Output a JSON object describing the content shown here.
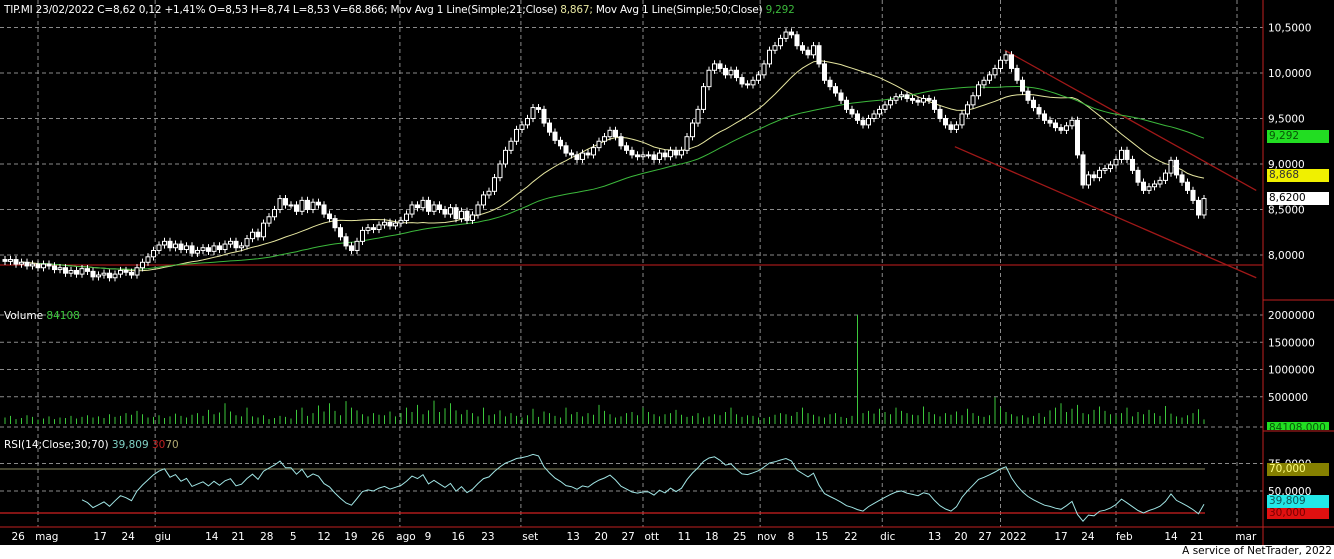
{
  "header": {
    "quote": "TIP.MI 23/02/2022 C=8,62 0,12 +1,41% O=8,53 H=8,74 L=8,53 V=68.866;",
    "ma21_label": "Mov Avg 1 Line(Simple;21;Close)",
    "ma21_value": "8,867;",
    "ma50_label": "Mov Avg 1 Line(Simple;50;Close)",
    "ma50_value": "9,292"
  },
  "volume_pane": {
    "label": "Volume",
    "value": "84108",
    "box": "84108,000"
  },
  "rsi_pane": {
    "label": "RSI(14;Close;30;70)",
    "value": "39,809",
    "low": "30",
    "high": "70",
    "box_high": "70,000",
    "box_value": "39,809",
    "box_low": "30,000"
  },
  "price_boxes": {
    "ma50": "9,292",
    "ma21": "8,868",
    "last": "8,6200"
  },
  "footer": "A service of NetTrader, 2022",
  "colors": {
    "ma21": "#e6e6a0",
    "ma50": "#3cb83c",
    "rsi": "#a0e4e4",
    "trend": "#a01818",
    "volume": "#3cc83c"
  },
  "chart_data": {
    "type": "candlestick",
    "symbol": "TIP.MI",
    "price_axis": {
      "ticks": [
        8.0,
        8.5,
        9.0,
        9.5,
        10.0,
        10.5
      ],
      "tick_labels": [
        "8,0000",
        "8,5000",
        "9,0000",
        "9,5000",
        "10,0000",
        "10,5000"
      ]
    },
    "volume_axis": {
      "ticks": [
        500000,
        1000000,
        1500000,
        2000000
      ],
      "tick_labels": [
        "500000",
        "1000000",
        "1500000",
        "2000000"
      ]
    },
    "rsi_axis": {
      "ticks": [
        50,
        75
      ],
      "tick_labels": [
        "50,0000",
        "75,0000"
      ],
      "levels": [
        30,
        70
      ]
    },
    "x_labels": [
      {
        "t": "26",
        "i": 2.4
      },
      {
        "t": "mag",
        "i": 7.6
      },
      {
        "t": "17",
        "i": 17.3
      },
      {
        "t": "24",
        "i": 22.4
      },
      {
        "t": "giu",
        "i": 28.7
      },
      {
        "t": "14",
        "i": 37.6
      },
      {
        "t": "21",
        "i": 42.4
      },
      {
        "t": "28",
        "i": 47.6
      },
      {
        "t": "5",
        "i": 52.4
      },
      {
        "t": "12",
        "i": 58
      },
      {
        "t": "19",
        "i": 62.9
      },
      {
        "t": "26",
        "i": 67.8
      },
      {
        "t": "ago",
        "i": 72.9
      },
      {
        "t": "9",
        "i": 76.9
      },
      {
        "t": "16",
        "i": 82.4
      },
      {
        "t": "23",
        "i": 87.8
      },
      {
        "t": "set",
        "i": 95.5
      },
      {
        "t": "13",
        "i": 103.3
      },
      {
        "t": "20",
        "i": 108.4
      },
      {
        "t": "27",
        "i": 113.3
      },
      {
        "t": "ott",
        "i": 117.6
      },
      {
        "t": "11",
        "i": 123.5
      },
      {
        "t": "18",
        "i": 128.5
      },
      {
        "t": "25",
        "i": 133.6
      },
      {
        "t": "nov",
        "i": 138.5
      },
      {
        "t": "8",
        "i": 142.9
      },
      {
        "t": "15",
        "i": 148.5
      },
      {
        "t": "22",
        "i": 153.8
      },
      {
        "t": "dic",
        "i": 160.5
      },
      {
        "t": "13",
        "i": 169
      },
      {
        "t": "20",
        "i": 173.8
      },
      {
        "t": "27",
        "i": 178.2
      },
      {
        "t": "2022",
        "i": 183.3
      },
      {
        "t": "17",
        "i": 192
      },
      {
        "t": "24",
        "i": 196.9
      },
      {
        "t": "feb",
        "i": 203.5
      },
      {
        "t": "14",
        "i": 212
      },
      {
        "t": "21",
        "i": 216.7
      },
      {
        "t": "mar",
        "i": 225.6
      }
    ],
    "month_gridlines": [
      6,
      27.3,
      71.8,
      93.8,
      116,
      137.3,
      159.5,
      181,
      202,
      224
    ],
    "support_level": 7.89,
    "trendlines": [
      {
        "from": [
          181.8,
          10.25
        ],
        "to": [
          227.5,
          8.71
        ]
      },
      {
        "from": [
          172.7,
          9.19
        ],
        "to": [
          227.5,
          7.75
        ]
      }
    ],
    "ma_periods": [
      21,
      50
    ],
    "rsi_period": 14,
    "close": [
      7.93,
      7.95,
      7.9,
      7.92,
      7.88,
      7.9,
      7.86,
      7.9,
      7.88,
      7.84,
      7.86,
      7.8,
      7.83,
      7.79,
      7.85,
      7.82,
      7.76,
      7.78,
      7.8,
      7.75,
      7.79,
      7.83,
      7.81,
      7.78,
      7.86,
      7.92,
      7.98,
      8.05,
      8.11,
      8.15,
      8.08,
      8.12,
      8.06,
      8.1,
      8.02,
      8.05,
      8.08,
      8.04,
      8.1,
      8.06,
      8.12,
      8.15,
      8.08,
      8.1,
      8.18,
      8.25,
      8.2,
      8.35,
      8.42,
      8.5,
      8.62,
      8.55,
      8.55,
      8.48,
      8.6,
      8.5,
      8.58,
      8.55,
      8.45,
      8.4,
      8.3,
      8.2,
      8.1,
      8.05,
      8.15,
      8.27,
      8.3,
      8.28,
      8.33,
      8.36,
      8.32,
      8.35,
      8.38,
      8.45,
      8.55,
      8.52,
      8.6,
      8.48,
      8.55,
      8.5,
      8.45,
      8.52,
      8.4,
      8.48,
      8.38,
      8.44,
      8.55,
      8.66,
      8.7,
      8.85,
      9.0,
      9.15,
      9.25,
      9.38,
      9.43,
      9.5,
      9.62,
      9.6,
      9.45,
      9.35,
      9.26,
      9.2,
      9.12,
      9.1,
      9.05,
      9.12,
      9.1,
      9.18,
      9.25,
      9.3,
      9.37,
      9.3,
      9.2,
      9.15,
      9.1,
      9.08,
      9.1,
      9.1,
      9.05,
      9.12,
      9.08,
      9.15,
      9.1,
      9.15,
      9.3,
      9.45,
      9.6,
      9.85,
      10.03,
      10.1,
      10.05,
      9.98,
      10.03,
      9.95,
      9.88,
      9.87,
      9.92,
      9.98,
      10.1,
      10.25,
      10.3,
      10.38,
      10.45,
      10.42,
      10.3,
      10.25,
      10.2,
      10.3,
      10.1,
      9.92,
      9.85,
      9.78,
      9.7,
      9.6,
      9.55,
      9.48,
      9.43,
      9.5,
      9.55,
      9.6,
      9.65,
      9.7,
      9.74,
      9.76,
      9.72,
      9.7,
      9.68,
      9.72,
      9.7,
      9.6,
      9.5,
      9.43,
      9.38,
      9.43,
      9.55,
      9.65,
      9.75,
      9.87,
      9.92,
      9.98,
      10.05,
      10.14,
      10.2,
      10.05,
      9.92,
      9.8,
      9.7,
      9.62,
      9.55,
      9.48,
      9.45,
      9.4,
      9.37,
      9.42,
      9.48,
      9.1,
      8.77,
      8.88,
      8.85,
      8.93,
      8.95,
      8.99,
      9.05,
      9.15,
      9.05,
      8.93,
      8.8,
      8.71,
      8.75,
      8.78,
      8.82,
      8.9,
      9.04,
      8.88,
      8.8,
      8.71,
      8.6,
      8.44,
      8.62
    ],
    "volume_k": [
      120,
      150,
      90,
      110,
      160,
      130,
      80,
      100,
      140,
      90,
      120,
      110,
      150,
      100,
      130,
      160,
      120,
      140,
      110,
      180,
      130,
      150,
      200,
      170,
      240,
      180,
      120,
      130,
      160,
      110,
      140,
      190,
      150,
      120,
      170,
      200,
      150,
      260,
      180,
      210,
      380,
      230,
      160,
      140,
      300,
      140,
      120,
      160,
      90,
      110,
      150,
      130,
      100,
      260,
      300,
      150,
      200,
      340,
      230,
      380,
      240,
      160,
      420,
      300,
      250,
      180,
      140,
      200,
      170,
      160,
      230,
      140,
      200,
      300,
      220,
      350,
      180,
      250,
      430,
      220,
      290,
      380,
      250,
      180,
      260,
      200,
      140,
      300,
      160,
      180,
      250,
      140,
      200,
      150,
      120,
      160,
      280,
      130,
      230,
      200,
      150,
      120,
      300,
      180,
      220,
      140,
      200,
      170,
      350,
      240,
      180,
      120,
      140,
      200,
      220,
      160,
      300,
      220,
      180,
      140,
      180,
      200,
      260,
      170,
      130,
      150,
      200,
      120,
      140,
      180,
      160,
      220,
      300,
      180,
      130,
      160,
      150,
      120,
      110,
      130,
      170,
      200,
      180,
      150,
      220,
      300,
      200,
      170,
      140,
      120,
      180,
      200,
      130,
      110,
      150,
      2000,
      200,
      240,
      190,
      280,
      220,
      180,
      300,
      240,
      200,
      170,
      160,
      320,
      220,
      180,
      140,
      200,
      170,
      230,
      160,
      280,
      200,
      150,
      130,
      160,
      490,
      300,
      220,
      180,
      140,
      160,
      120,
      150,
      200,
      130,
      250,
      300,
      380,
      220,
      280,
      350,
      200,
      180,
      260,
      320,
      240,
      180,
      160,
      200,
      300,
      140,
      220,
      180,
      260,
      200,
      150,
      330,
      190,
      140,
      120,
      160,
      200,
      270,
      84
    ]
  }
}
